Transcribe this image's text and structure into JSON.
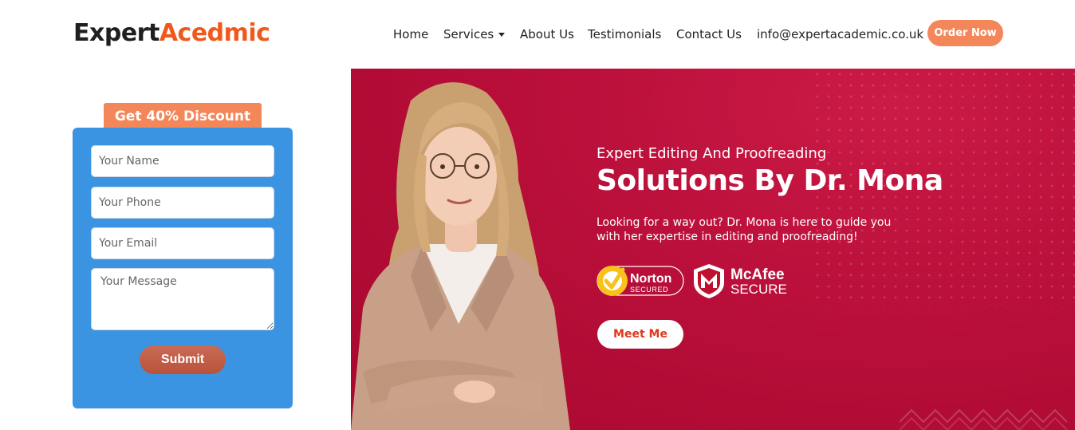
{
  "header": {
    "logo_part1": "Expert",
    "logo_part2": "Acedmic",
    "nav": {
      "home": "Home",
      "services": "Services",
      "about": "About Us",
      "testimonials": "Testimonials",
      "contact": "Contact Us",
      "email": "info@expertacademic.co.uk"
    },
    "order_button": "Order Now"
  },
  "form": {
    "discount_label": "Get 40% Discount",
    "name_placeholder": "Your Name",
    "phone_placeholder": "Your Phone",
    "email_placeholder": "Your Email",
    "message_placeholder": "Your Message",
    "submit_label": "Submit"
  },
  "hero": {
    "subtitle": "Expert Editing And Proofreading",
    "title": "Solutions By Dr. Mona",
    "description": "Looking for a way out? Dr. Mona is here to guide you with her expertise in editing and proofreading!",
    "badges": {
      "norton_name": "Norton",
      "norton_sub": "SECURED",
      "mcafee_name": "McAfee",
      "mcafee_sub": "SECURE"
    },
    "meet_button": "Meet Me"
  },
  "colors": {
    "brand_orange": "#ef5a1c",
    "button_orange": "#f4875a",
    "form_blue": "#3b94e2",
    "hero_red": "#b90f3a"
  }
}
